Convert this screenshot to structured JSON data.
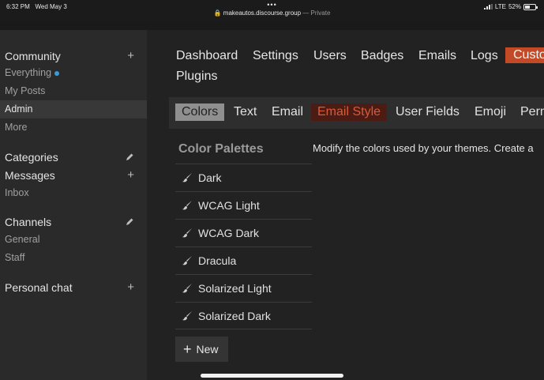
{
  "status_bar": {
    "time": "6:32 PM",
    "date": "Wed May 3",
    "dots": "•••",
    "url": "makeautos.discourse.group",
    "private_label": "— Private",
    "network": "LTE",
    "battery": "52%",
    "battery_level": 0.52
  },
  "sidebar": {
    "community": {
      "title": "Community",
      "action": "+",
      "items": [
        {
          "label": "Everything"
        },
        {
          "label": "My Posts"
        },
        {
          "label": "Admin"
        },
        {
          "label": "More"
        }
      ]
    },
    "categories": {
      "title": "Categories"
    },
    "messages": {
      "title": "Messages",
      "action": "+",
      "items": [
        {
          "label": "Inbox"
        }
      ]
    },
    "channels": {
      "title": "Channels",
      "items": [
        {
          "label": "General"
        },
        {
          "label": "Staff"
        }
      ]
    },
    "personal_chat": {
      "title": "Personal chat",
      "action": "+"
    }
  },
  "admin_nav": {
    "items": [
      {
        "label": "Dashboard"
      },
      {
        "label": "Settings"
      },
      {
        "label": "Users"
      },
      {
        "label": "Badges"
      },
      {
        "label": "Emails"
      },
      {
        "label": "Logs"
      },
      {
        "label": "Custo"
      },
      {
        "label": "Plugins"
      }
    ]
  },
  "sub_nav": {
    "items": [
      {
        "label": "Colors"
      },
      {
        "label": "Text"
      },
      {
        "label": "Email"
      },
      {
        "label": "Email Style"
      },
      {
        "label": "User Fields"
      },
      {
        "label": "Emoji"
      },
      {
        "label": "Perm"
      }
    ]
  },
  "palettes": {
    "title": "Color Palettes",
    "items": [
      {
        "label": "Dark"
      },
      {
        "label": "WCAG Light"
      },
      {
        "label": "WCAG Dark"
      },
      {
        "label": "Dracula"
      },
      {
        "label": "Solarized Light"
      },
      {
        "label": "Solarized Dark"
      }
    ],
    "new_label": "New",
    "new_icon": "+"
  },
  "description": "Modify the colors used by your themes. Create a",
  "colors": {
    "accent": "#c24a26",
    "active_tab": "#8f8f8f",
    "unread_dot": "#3a9ad9"
  }
}
